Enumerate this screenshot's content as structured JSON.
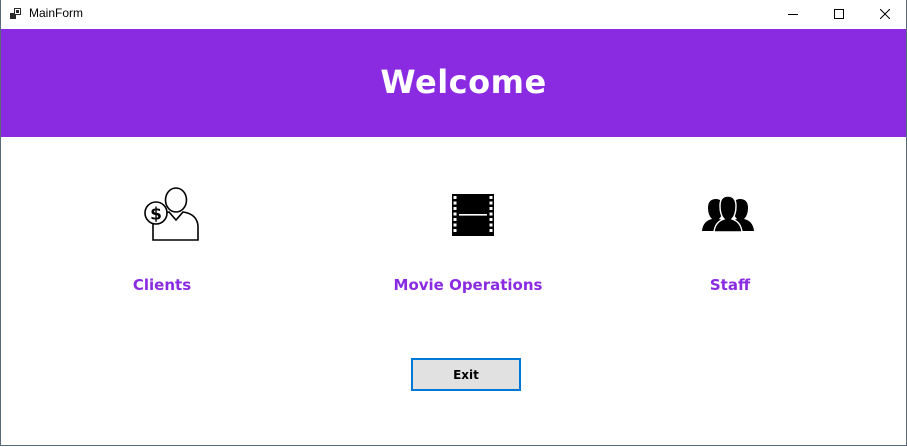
{
  "window": {
    "title": "MainForm",
    "controls": {
      "minimize_icon": "minimize-icon",
      "maximize_icon": "maximize-icon",
      "close_icon": "close-icon"
    }
  },
  "header": {
    "title": "Welcome",
    "background_color": "#8a2be2",
    "text_color": "#ffffff"
  },
  "nav": {
    "items": [
      {
        "label": "Clients",
        "icon": "client-money-user-icon"
      },
      {
        "label": "Movie Operations",
        "icon": "film-strip-icon"
      },
      {
        "label": "Staff",
        "icon": "group-users-icon"
      }
    ],
    "label_color": "#8a2be2"
  },
  "exit_button": {
    "label": "Exit",
    "border_color": "#0078d7",
    "background_color": "#e1e1e1"
  }
}
